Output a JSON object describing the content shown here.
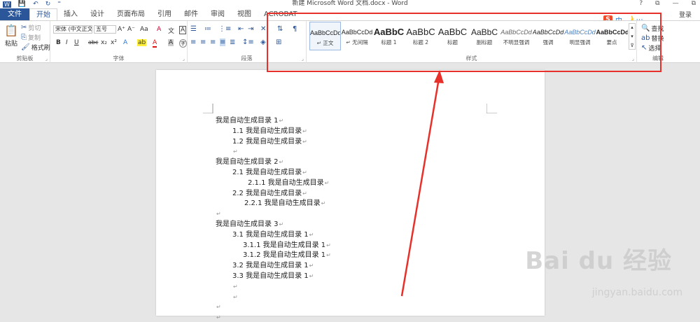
{
  "titlebar": {
    "title": "新建 Microsoft Word 文档.docx - Word",
    "help": "?",
    "restore": "⧉",
    "minimize": "—",
    "close": "⧉"
  },
  "tabs": {
    "file": "文件",
    "home": "开始",
    "insert": "插入",
    "design": "设计",
    "layout": "页面布局",
    "references": "引用",
    "mailings": "邮件",
    "review": "审阅",
    "view": "视图",
    "acrobat": "ACROBAT",
    "login": "登录"
  },
  "clipboard": {
    "paste": "粘贴",
    "cut": "剪切",
    "copy": "复制",
    "format_painter": "格式刷",
    "label": "剪贴板"
  },
  "font": {
    "font_name": "宋体 (中文正文)",
    "font_size": "五号",
    "label": "字体",
    "bold": "B",
    "italic": "I",
    "underline": "U",
    "strike": "abc",
    "sub": "x₂",
    "sup": "x²",
    "grow": "A⁺",
    "shrink": "A⁻",
    "case": "Aa",
    "clear": "A",
    "color_a": "A",
    "highlight": "ab",
    "char_shade": "A",
    "char_border": "A",
    "phonetic": "文"
  },
  "paragraph": {
    "label": "段落"
  },
  "styles": {
    "label": "样式",
    "items": [
      {
        "sample": "AaBbCcDd",
        "name": "↵ 正文"
      },
      {
        "sample": "AaBbCcDd",
        "name": "↵ 无间隔"
      },
      {
        "sample": "AaBbC",
        "name": "标题 1"
      },
      {
        "sample": "AaBbC",
        "name": "标题 2"
      },
      {
        "sample": "AaBbC",
        "name": "标题"
      },
      {
        "sample": "AaBbC",
        "name": "副标题"
      },
      {
        "sample": "AaBbCcDd",
        "name": "不明显强调"
      },
      {
        "sample": "AaBbCcDd",
        "name": "强调"
      },
      {
        "sample": "AaBbCcDd",
        "name": "明显强调"
      },
      {
        "sample": "AaBbCcDd",
        "name": "要点"
      }
    ]
  },
  "editing": {
    "find": "查找",
    "replace": "替换",
    "select": "选择",
    "label": "编辑"
  },
  "ime": {
    "lang": "中",
    "icons": "🌙 ⋯"
  },
  "document": {
    "lines": [
      {
        "text": "我是自动生成目录 1",
        "level": 0
      },
      {
        "text": "1.1 我是自动生成目录",
        "level": 1
      },
      {
        "text": "1.2 我是自动生成目录",
        "level": 1
      },
      {
        "text": "",
        "level": 1
      },
      {
        "text": "我是自动生成目录 2",
        "level": 0
      },
      {
        "text": "2.1 我是自动生成目录",
        "level": 1
      },
      {
        "text": "2.1.1 我是自动生成目录",
        "level": 2
      },
      {
        "text": "2.2 我是自动生成目录",
        "level": 1
      },
      {
        "text": "2.2.1 我是自动生成目录",
        "level": 2
      },
      {
        "text": "",
        "level": 0
      },
      {
        "text": "我是自动生成目录 3",
        "level": 0
      },
      {
        "text": "3.1 我是自动生成目录 1",
        "level": 1
      },
      {
        "text": "3.1.1 我是自动生成目录 1",
        "level": 2
      },
      {
        "text": "3.1.2 我是自动生成目录 1",
        "level": 2
      },
      {
        "text": "3.2 我是自动生成目录 1",
        "level": 1
      },
      {
        "text": "3.3 我是自动生成目录 1",
        "level": 1
      },
      {
        "text": "",
        "level": 1
      },
      {
        "text": "",
        "level": 1
      },
      {
        "text": "",
        "level": 0
      },
      {
        "text": "",
        "level": 0
      }
    ]
  },
  "watermark": {
    "brand": "Bai du 经验",
    "url": "jingyan.baidu.com"
  },
  "annotation": {
    "color": "#e8302a"
  }
}
